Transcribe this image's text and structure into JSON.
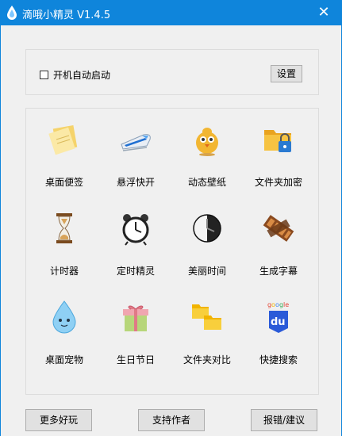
{
  "window": {
    "title": "滴哦小精灵 V1.4.5",
    "close_symbol": "✕"
  },
  "autostart": {
    "label": "开机自动启动",
    "checked": false
  },
  "settings_button": "设置",
  "tools": [
    {
      "label": "桌面便签",
      "icon": "sticky-notes-icon"
    },
    {
      "label": "悬浮快开",
      "icon": "bullet-train-icon"
    },
    {
      "label": "动态壁纸",
      "icon": "chick-icon"
    },
    {
      "label": "文件夹加密",
      "icon": "folder-lock-icon"
    },
    {
      "label": "计时器",
      "icon": "hourglass-icon"
    },
    {
      "label": "定时精灵",
      "icon": "alarm-clock-icon"
    },
    {
      "label": "美丽时间",
      "icon": "clock-face-icon"
    },
    {
      "label": "生成字幕",
      "icon": "film-strip-icon"
    },
    {
      "label": "桌面宠物",
      "icon": "water-drop-pet-icon"
    },
    {
      "label": "生日节日",
      "icon": "gift-box-icon"
    },
    {
      "label": "文件夹对比",
      "icon": "folders-compare-icon"
    },
    {
      "label": "快捷搜索",
      "icon": "baidu-search-icon"
    }
  ],
  "footer": {
    "more_fun": "更多好玩",
    "support_author": "支持作者",
    "feedback": "报错/建议"
  }
}
